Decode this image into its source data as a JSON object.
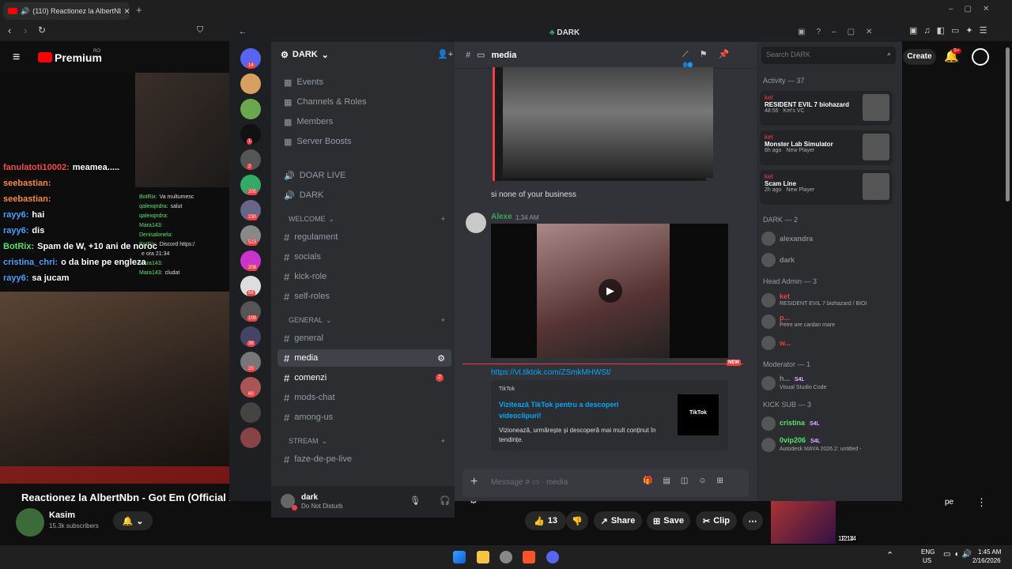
{
  "browser": {
    "tab_title": "(110) Reactionez la AlbertNbn",
    "tab_close": "×",
    "new_tab": "+"
  },
  "youtube": {
    "logo": "Premium",
    "logo_region": "RO",
    "create_label": "Create",
    "notification_count": "9+",
    "video_title": "Reactionez la AlbertNbn - Got Em (Official M",
    "channel_name": "Kasim",
    "subscribers": "15.3k subscribers",
    "likes": "13",
    "share_label": "Share",
    "save_label": "Save",
    "clip_label": "Clip",
    "miniplayer_time": "12:14",
    "more_label": "pe",
    "chat": [
      {
        "user": "fanulatoti10002:",
        "text": "meamea.....",
        "color": "#ff4b4b"
      },
      {
        "user": "seebastian:",
        "text": "",
        "color": "#ff8c3a"
      },
      {
        "user": "seebastian:",
        "text": "",
        "color": "#ff8c3a"
      },
      {
        "user": "rayy6:",
        "text": "hai",
        "color": "#4aa3ff"
      },
      {
        "user": "rayy6:",
        "text": "dis",
        "color": "#4aa3ff"
      },
      {
        "user": "BotRix:",
        "text": "Spam de W, +10 ani de noroc",
        "color": "#54e36a"
      },
      {
        "user": "cristina_chri:",
        "text": "o da bine pe engleza",
        "color": "#4aa3ff"
      },
      {
        "user": "rayy6:",
        "text": "sa jucam",
        "color": "#4aa3ff"
      }
    ],
    "small_chat": [
      {
        "user": "BotRix:",
        "text": "Va multumesc"
      },
      {
        "user": "qalexqndra:",
        "text": "salut"
      },
      {
        "user": "qalexqndra:",
        "text": ""
      },
      {
        "user": "Mara143:",
        "text": ""
      },
      {
        "user": "Denisalonela:",
        "text": ""
      },
      {
        "user": "BotRix:",
        "text": "Discord https:/"
      },
      {
        "user": "",
        "text": "e ora 21:34"
      },
      {
        "user": "Mara143:",
        "text": ""
      },
      {
        "user": "Mara143:",
        "text": "cludat"
      }
    ]
  },
  "discord": {
    "window_title": "DARK",
    "server_name": "DARK",
    "channel_name": "media",
    "search_placeholder": "Search DARK",
    "guild_badges": [
      "14",
      "1",
      "2",
      "205",
      "230",
      "523",
      "208",
      "68",
      "109",
      "38",
      "20",
      "60"
    ],
    "server_menu": [
      "Events",
      "Channels & Roles",
      "Members",
      "Server Boosts"
    ],
    "voice_channels": [
      "DOAR LIVE",
      "DARK"
    ],
    "categories": [
      {
        "name": "WELCOME",
        "channels": [
          "regulament",
          "socials",
          "kick-role",
          "self-roles"
        ]
      },
      {
        "name": "GENERAL",
        "channels": [
          "general",
          "media",
          "comenzi",
          "mods-chat",
          "among-us"
        ]
      },
      {
        "name": "STREAM",
        "channels": [
          "faze-de-pe-live"
        ]
      }
    ],
    "comenzi_badge": "2",
    "user": {
      "name": "dark",
      "status": "Do Not Disturb"
    },
    "messages": {
      "first_text": "si none of your business",
      "author": "Alexe",
      "time": "1:34 AM",
      "link": "https://vt.tiktok.com/ZSmkMHWSt/",
      "new_label": "NEW",
      "embed_provider": "TikTok",
      "embed_title": "Vizitează TikTok pentru a descoperi videoclipuri!",
      "embed_desc": "Vizionează, urmărește și descoperă mai mult conținut în tendințe.",
      "embed_logo": "TikTok"
    },
    "composer_placeholder": "Message #",
    "composer_channel": "media",
    "members": {
      "activity_header": "Activity — 37",
      "activities": [
        {
          "user": "ket",
          "game": "RESIDENT EVIL 7 biohazard",
          "meta": "48:56",
          "vc": "Ket's VC"
        },
        {
          "user": "ket",
          "game": "Monster Lab Simulator",
          "meta": "6h ago",
          "vc": "New Player"
        },
        {
          "user": "ket",
          "game": "Scam Line",
          "meta": "2h ago",
          "vc": "New Player"
        }
      ],
      "sections": [
        {
          "header": "DARK — 2",
          "rows": [
            {
              "name": "alexandra",
              "sub": ""
            },
            {
              "name": "dark",
              "sub": ""
            }
          ]
        },
        {
          "header": "Head Admin — 3",
          "rows": [
            {
              "name": "ket",
              "sub": "RESIDENT EVIL 7 biohazard / BIOI"
            },
            {
              "name": "p...",
              "sub": "Petre are cardan mare"
            },
            {
              "name": "w...",
              "sub": ""
            }
          ]
        },
        {
          "header": "Moderator — 1",
          "rows": [
            {
              "name": "h...",
              "sub": "Visual Studio Code",
              "tag": "S4L"
            }
          ]
        },
        {
          "header": "KICK SUB — 3",
          "rows": [
            {
              "name": "cristina",
              "sub": "",
              "tag": "S4L"
            },
            {
              "name": "0vip206",
              "sub": "Autodesk MAYA 2026.2: untitled -",
              "tag": "S4L"
            }
          ]
        }
      ]
    }
  },
  "taskbar": {
    "lang": "ENG",
    "region": "US",
    "time": "1:45 AM",
    "date": "2/16/2026"
  },
  "colors": {
    "discord_bg": "#313338",
    "youtube_red": "#ff0000",
    "dnd": "#f23f43",
    "link": "#00a8fc"
  }
}
